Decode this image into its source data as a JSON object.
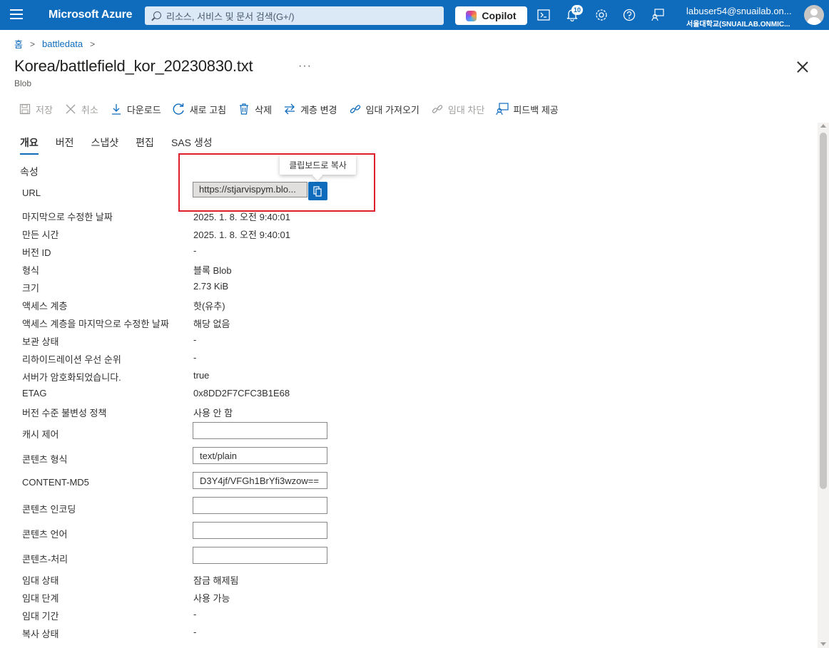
{
  "topbar": {
    "brand": "Microsoft Azure",
    "search_placeholder": "리소스, 서비스 및 문서 검색(G+/)",
    "copilot_label": "Copilot",
    "notification_count": "10",
    "user_email": "labuser54@snuailab.on...",
    "user_tenant": "서울대학교(SNUAILAB.ONMIC..."
  },
  "breadcrumb": {
    "home": "홈",
    "parent": "battledata",
    "sep": ">"
  },
  "header": {
    "title": "Korea/battlefield_kor_20230830.txt",
    "ellipsis": "···",
    "subtitle": "Blob"
  },
  "toolbar": {
    "save": "저장",
    "cancel": "취소",
    "download": "다운로드",
    "refresh": "새로 고침",
    "delete": "삭제",
    "change_tier": "계층 변경",
    "acquire_lease": "임대 가져오기",
    "break_lease": "임대 차단",
    "feedback": "피드백 제공"
  },
  "tabs": [
    "개요",
    "버전",
    "스냅샷",
    "편집",
    "SAS 생성"
  ],
  "section_title": "속성",
  "url": {
    "label": "URL",
    "value": "https://stjarvispym.blo...",
    "tooltip": "클립보드로 복사"
  },
  "properties": [
    {
      "label": "마지막으로 수정한 날짜",
      "value": "2025. 1. 8. 오전 9:40:01"
    },
    {
      "label": "만든 시간",
      "value": "2025. 1. 8. 오전 9:40:01"
    },
    {
      "label": "버전 ID",
      "value": "-"
    },
    {
      "label": "형식",
      "value": "블록 Blob"
    },
    {
      "label": "크기",
      "value": "2.73 KiB"
    },
    {
      "label": "액세스 계층",
      "value": "핫(유추)"
    },
    {
      "label": "액세스 계층을 마지막으로 수정한 날짜",
      "value": "해당 없음"
    },
    {
      "label": "보관 상태",
      "value": "-"
    },
    {
      "label": "리하이드레이션 우선 순위",
      "value": "-"
    },
    {
      "label": "서버가 암호화되었습니다.",
      "value": "true"
    },
    {
      "label": "ETAG",
      "value": "0x8DD2F7CFC3B1E68"
    },
    {
      "label": "버전 수준 불변성 정책",
      "value": "사용 안 함"
    }
  ],
  "inputs": [
    {
      "label": "캐시 제어",
      "value": ""
    },
    {
      "label": "콘텐츠 형식",
      "value": "text/plain"
    },
    {
      "label": "CONTENT-MD5",
      "value": "D3Y4jf/VFGh1BrYfi3wzow=="
    },
    {
      "label": "콘텐츠 인코딩",
      "value": ""
    },
    {
      "label": "콘텐츠 언어",
      "value": ""
    },
    {
      "label": "콘텐츠-처리",
      "value": ""
    }
  ],
  "lease": [
    {
      "label": "임대 상태",
      "value": "잠금 해제됨"
    },
    {
      "label": "임대 단계",
      "value": "사용 가능"
    },
    {
      "label": "임대 기간",
      "value": "-"
    },
    {
      "label": "복사 상태",
      "value": "-"
    }
  ]
}
